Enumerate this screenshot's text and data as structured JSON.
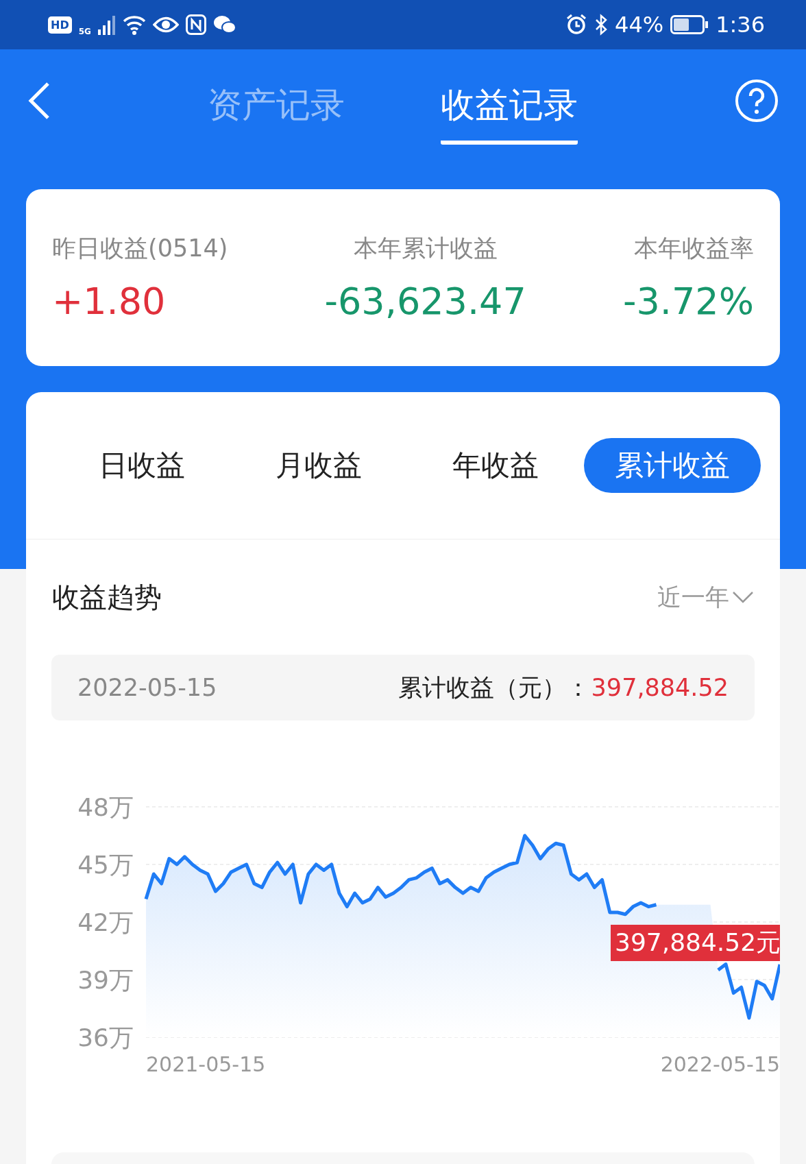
{
  "status_bar": {
    "hd": "HD",
    "network": "5G",
    "battery": "44%",
    "time": "1:36"
  },
  "header": {
    "tabs": [
      {
        "label": "资产记录",
        "selected": false
      },
      {
        "label": "收益记录",
        "selected": true
      }
    ]
  },
  "summary": [
    {
      "label": "昨日收益(0514)",
      "value": "+1.80",
      "color": "#e0303b"
    },
    {
      "label": "本年累计收益",
      "value": "-63,623.47",
      "color": "#17966b"
    },
    {
      "label": "本年收益率",
      "value": "-3.72%",
      "color": "#17966b"
    }
  ],
  "period_tabs": [
    {
      "label": "日收益",
      "selected": false
    },
    {
      "label": "月收益",
      "selected": false
    },
    {
      "label": "年收益",
      "selected": false
    },
    {
      "label": "累计收益",
      "selected": true
    }
  ],
  "trend": {
    "title": "收益趋势",
    "range": "近一年",
    "date": "2022-05-15",
    "total_label": "累计收益（元）：",
    "total_value": "397,884.52",
    "tooltip": "397,884.52元",
    "date_start": "2021-05-15",
    "date_end": "2022-05-15",
    "chart_data": {
      "type": "area",
      "grid": true,
      "ylim": [
        36,
        48
      ],
      "yticks": [
        {
          "value": 36,
          "label": "36万"
        },
        {
          "value": 39,
          "label": "39万"
        },
        {
          "value": 42,
          "label": "42万"
        },
        {
          "value": 45,
          "label": "45万"
        },
        {
          "value": 48,
          "label": "48万"
        }
      ],
      "series": [
        {
          "color": "#1f7cf5",
          "values": [
            43.2,
            44.5,
            44,
            45.3,
            45,
            45.4,
            45,
            44.7,
            44.5,
            43.6,
            44,
            44.6,
            44.8,
            45,
            44,
            43.8,
            44.6,
            45.1,
            44.5,
            45,
            43,
            44.5,
            45,
            44.7,
            45,
            43.5,
            42.8,
            43.5,
            43,
            43.2,
            43.8,
            43.3,
            43.5,
            43.8,
            44.2,
            44.3,
            44.6,
            44.8,
            44,
            44.2,
            43.8,
            43.5,
            43.8,
            43.6,
            44.3,
            44.6,
            44.8,
            45,
            45.1,
            46.5,
            46,
            45.3,
            45.8,
            46.1,
            46,
            44.5,
            44.2,
            44.5,
            43.8,
            44.2,
            42.5,
            42.5,
            42.4,
            42.8,
            43,
            42.8,
            42.9,
            null,
            null,
            null,
            null,
            null,
            null,
            null,
            39.5,
            39.8,
            38.3,
            38.6,
            37,
            38.9,
            38.7,
            38,
            39.79
          ]
        }
      ]
    }
  }
}
